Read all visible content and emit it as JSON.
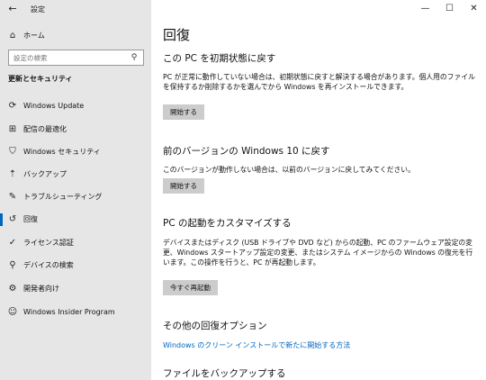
{
  "window": {
    "app_title": "設定",
    "back_icon": "arrow-left-icon",
    "controls": {
      "minimize": "—",
      "maximize": "☐",
      "close": "✕"
    }
  },
  "sidebar": {
    "home_label": "ホーム",
    "search_placeholder": "設定の検索",
    "section_title": "更新とセキュリティ",
    "items": [
      {
        "label": "Windows Update",
        "icon": "refresh-icon",
        "glyph": "⟳"
      },
      {
        "label": "配信の最適化",
        "icon": "delivery-optimization-icon",
        "glyph": "⊞"
      },
      {
        "label": "Windows セキュリティ",
        "icon": "shield-icon",
        "glyph": "⛉"
      },
      {
        "label": "バックアップ",
        "icon": "backup-icon",
        "glyph": "⇡"
      },
      {
        "label": "トラブルシューティング",
        "icon": "wrench-icon",
        "glyph": "✎"
      },
      {
        "label": "回復",
        "icon": "recovery-icon",
        "glyph": "↺",
        "active": true
      },
      {
        "label": "ライセンス認証",
        "icon": "activation-icon",
        "glyph": "✓"
      },
      {
        "label": "デバイスの検索",
        "icon": "find-device-icon",
        "glyph": "⚲"
      },
      {
        "label": "開発者向け",
        "icon": "developer-icon",
        "glyph": "⚙"
      },
      {
        "label": "Windows Insider Program",
        "icon": "insider-icon",
        "glyph": "☺"
      }
    ]
  },
  "main": {
    "title": "回復",
    "reset": {
      "heading": "この PC を初期状態に戻す",
      "text": "PC が正常に動作していない場合は、初期状態に戻すと解決する場合があります。個人用のファイルを保持するか削除するかを選んでから Windows を再インストールできます。",
      "button": "開始する"
    },
    "goback": {
      "heading": "前のバージョンの Windows 10 に戻す",
      "text": "このバージョンが動作しない場合は、以前のバージョンに戻してみてください。",
      "button": "開始する"
    },
    "advanced": {
      "heading": "PC の起動をカスタマイズする",
      "text": "デバイスまたはディスク (USB ドライブや DVD など) からの起動、PC のファームウェア設定の変更、Windows スタートアップ設定の変更、またはシステム イメージからの Windows の復元を行います。この操作を行うと、PC が再起動します。",
      "button": "今すぐ再起動"
    },
    "more": {
      "heading": "その他の回復オプション",
      "link": "Windows のクリーン インストールで新たに開始する方法"
    },
    "backup": {
      "heading": "ファイルをバックアップする"
    }
  }
}
